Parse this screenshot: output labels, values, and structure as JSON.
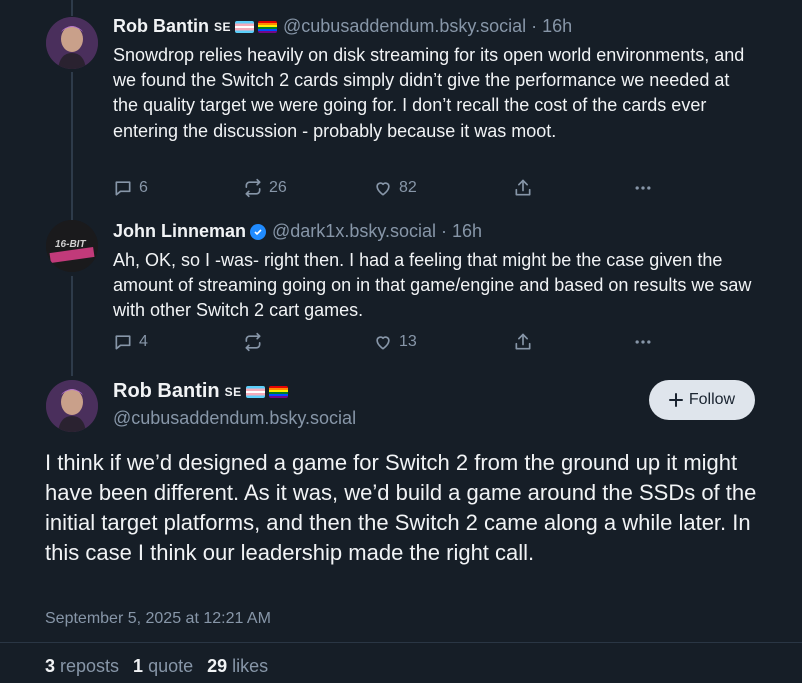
{
  "replies": [
    {
      "author": "Rob Bantin",
      "badge": "SE",
      "handle": "@cubusaddendum.bsky.social",
      "time": "16h",
      "text": "Snowdrop relies heavily on disk streaming for its open world environments, and we found the Switch 2 cards simply didn’t give the performance we needed at the quality target we were going for. I don’t recall the cost of the cards ever entering the discussion - probably because it was moot.",
      "replies_count": "6",
      "reposts_count": "26",
      "likes_count": "82"
    },
    {
      "author": "John Linneman",
      "handle": "@dark1x.bsky.social",
      "time": "16h",
      "avatar_text": "16-BIT",
      "text": "Ah, OK, so I -was- right then. I had a feeling that might be the case given the amount of streaming going on in that game/engine and based on results we saw with other Switch 2 cart games.",
      "replies_count": "4",
      "reposts_count": "",
      "likes_count": "13"
    }
  ],
  "main_post": {
    "author": "Rob Bantin",
    "badge": "SE",
    "handle": "@cubusaddendum.bsky.social",
    "follow_label": "Follow",
    "text": "I think if we’d designed a game for Switch 2 from the ground up it might have been different. As it was, we’d build a game around the SSDs of the initial target platforms, and then the Switch 2 came along a while later. In this case I think our leadership made the right call.",
    "date": "September 5, 2025 at 12:21 AM",
    "stats": {
      "reposts_value": "3",
      "reposts_label": "reposts",
      "quotes_value": "1",
      "quotes_label": "quote",
      "likes_value": "29",
      "likes_label": "likes"
    }
  },
  "colors": {
    "background": "#161e27",
    "text": "#f1f3f5",
    "muted": "#8796a8",
    "verified": "#208bfe",
    "follow_bg": "#dfe5ec"
  },
  "icons": [
    "reply-icon",
    "repost-icon",
    "like-icon",
    "share-icon",
    "more-icon",
    "verified-icon",
    "plus-icon"
  ]
}
